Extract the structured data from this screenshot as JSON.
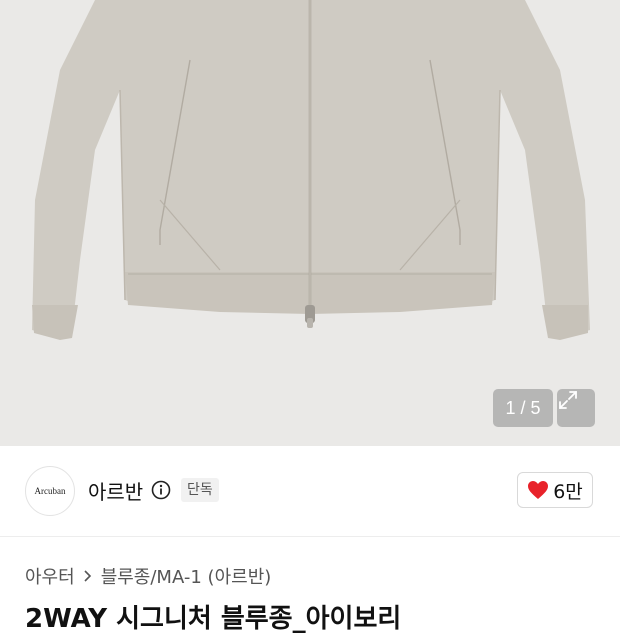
{
  "gallery": {
    "counter": "1 / 5",
    "expand_icon": "expand-icon",
    "background": "#eae9e7",
    "jacket_color": "#cfcbc3"
  },
  "brand": {
    "logo_text": "Arcuban",
    "name": "아르반",
    "info_icon": "info-icon",
    "badge": "단독"
  },
  "likes": {
    "icon": "heart-icon",
    "count": "6만",
    "heart_color": "#e8222a"
  },
  "breadcrumb": {
    "category": "아우터",
    "separator_icon": "chevron-right-icon",
    "subcategory": "블루종/MA-1 (아르반)"
  },
  "product": {
    "title": "2WAY 시그니처 블루종_아이보리"
  }
}
